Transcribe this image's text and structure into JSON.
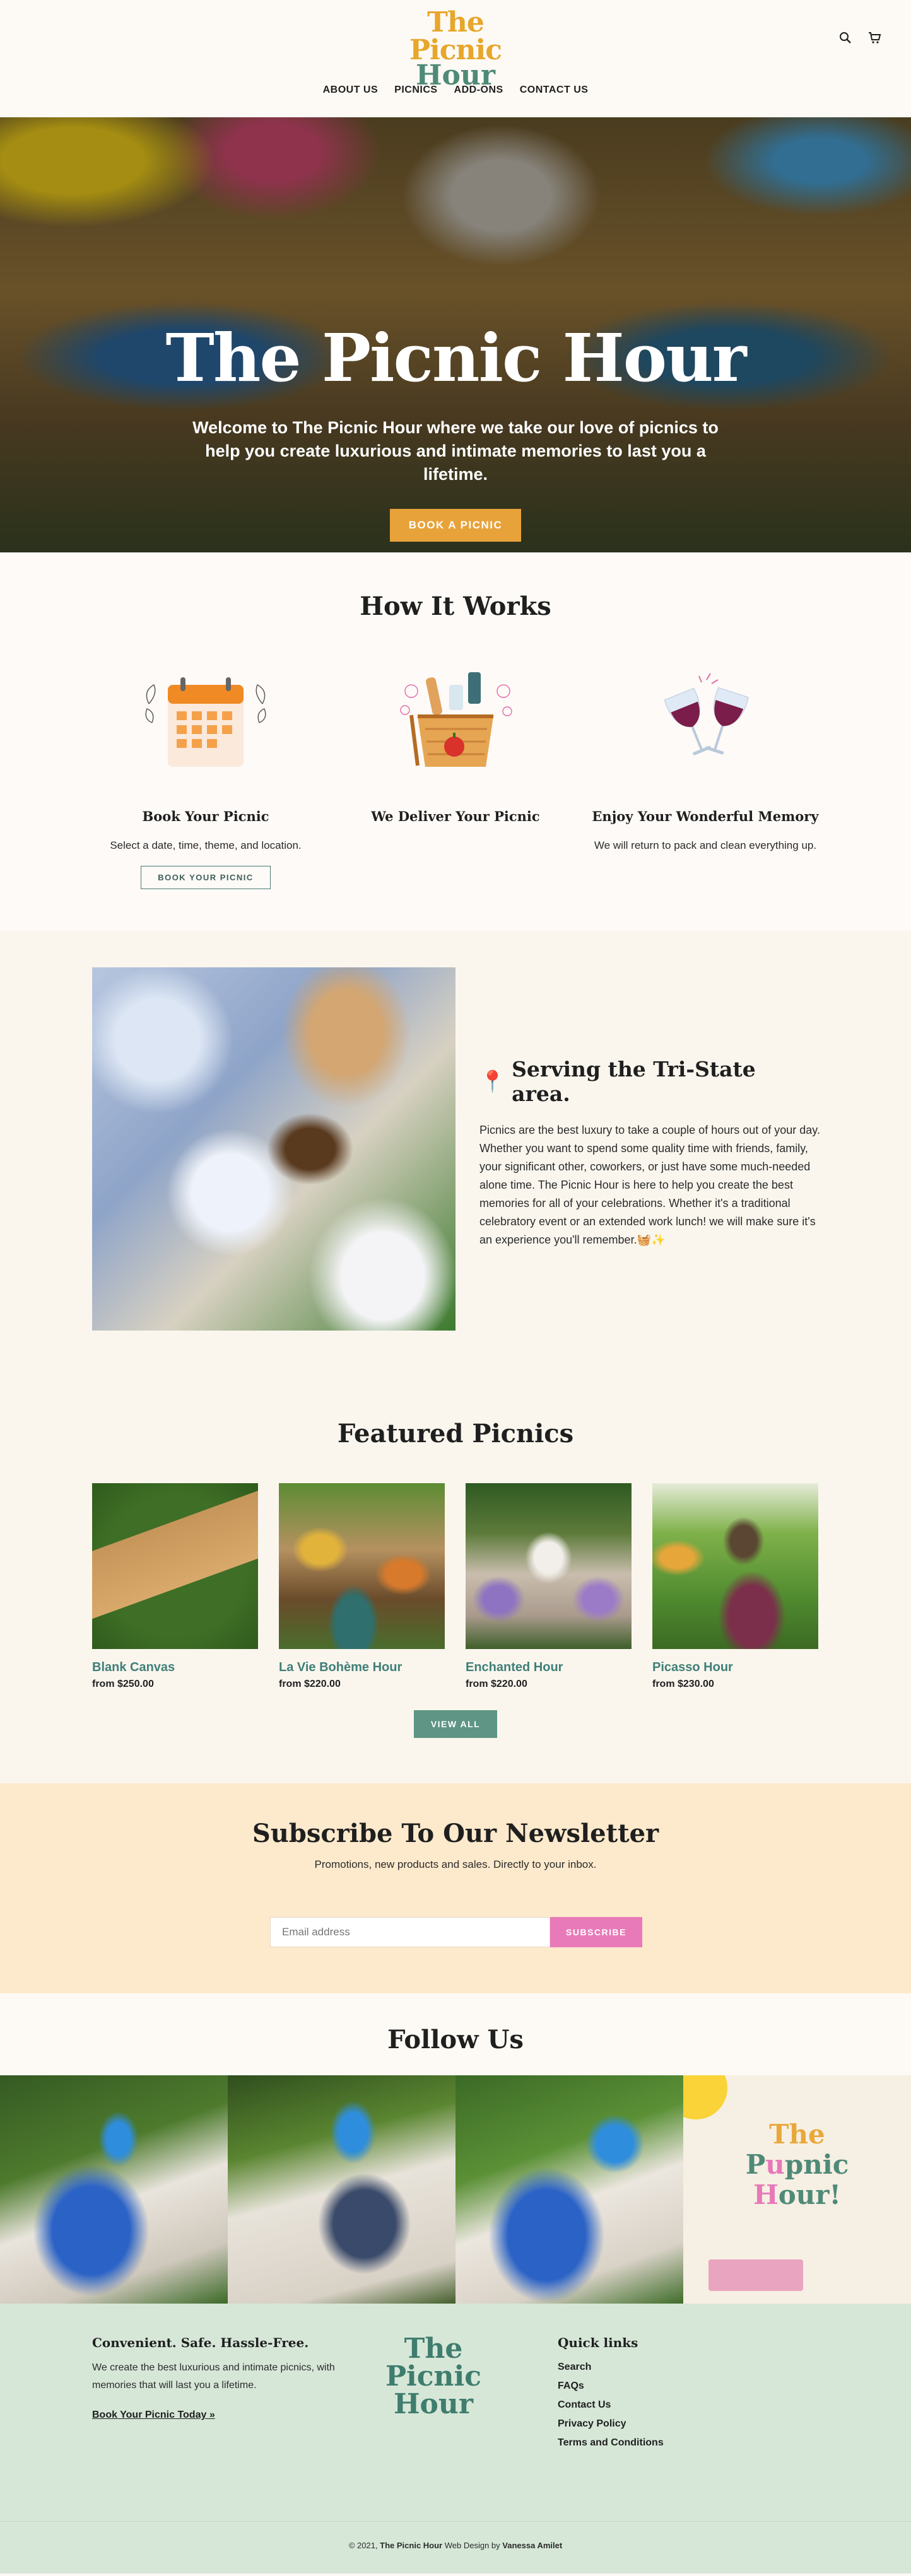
{
  "header": {
    "logo_line1": "The Picnic",
    "logo_line2": "Hour",
    "search_icon": "search-icon",
    "cart_icon": "cart-icon",
    "nav": [
      "ABOUT US",
      "PICNICS",
      "ADD-ONS",
      "CONTACT US"
    ]
  },
  "hero": {
    "title": "The Picnic Hour",
    "text": "Welcome to The Picnic Hour where we take our love of picnics to help you create luxurious and intimate memories to last you a lifetime.",
    "button": "BOOK A PICNIC"
  },
  "how": {
    "title": "How It Works",
    "steps": [
      {
        "title": "Book Your Picnic",
        "text": "Select a date, time, theme, and location.",
        "button": "BOOK YOUR PICNIC"
      },
      {
        "title": "We Deliver Your Picnic",
        "text": ""
      },
      {
        "title": "Enjoy Your Wonderful Memory",
        "text": "We will return to pack and clean everything up."
      }
    ]
  },
  "serving": {
    "pin": "📍",
    "title": "Serving the Tri-State area.",
    "body": "Picnics are the best luxury to take a couple of hours out of your day. Whether you want to spend some quality time with friends, family, your significant other, coworkers, or just have some much-needed alone time. The Picnic Hour is here to help you create the best memories for all of your celebrations. Whether it's a traditional celebratory event or an extended work lunch! we will make sure it's an experience you'll remember.🧺✨"
  },
  "featured": {
    "title": "Featured Picnics",
    "products": [
      {
        "name": "Blank Canvas",
        "price": "from $250.00"
      },
      {
        "name": "La Vie Bohème Hour",
        "price": "from $220.00"
      },
      {
        "name": "Enchanted Hour",
        "price": "from $220.00"
      },
      {
        "name": "Picasso Hour",
        "price": "from $230.00"
      }
    ],
    "view_all": "VIEW ALL"
  },
  "newsletter": {
    "title": "Subscribe To Our Newsletter",
    "subtitle": "Promotions, new products and sales. Directly to your inbox.",
    "placeholder": "Email address",
    "button": "SUBSCRIBE"
  },
  "follow": {
    "title": "Follow Us",
    "promo_line1": "The",
    "promo_line2a": "P",
    "promo_line2b": "u",
    "promo_line2c": "pnic",
    "promo_line3a": "H",
    "promo_line3b": "our!"
  },
  "footer": {
    "col1_title": "Convenient. Safe. Hassle-Free.",
    "col1_text": "We create the best luxurious and intimate picnics, with memories that will last you a lifetime.",
    "col1_link": "Book Your Picnic Today »",
    "logo_line1": "The",
    "logo_line2": "Picnic",
    "logo_line3": "Hour",
    "col3_title": "Quick links",
    "links": [
      "Search",
      "FAQs",
      "Contact Us",
      "Privacy Policy",
      "Terms and Conditions"
    ]
  },
  "copyright": {
    "prefix": "© 2021, ",
    "brand": "The Picnic Hour",
    "middle": " Web Design by ",
    "designer": "Vanessa Amilet"
  },
  "colors": {
    "accent_orange": "#e8a23a",
    "accent_pink": "#e97ab9",
    "accent_teal": "#5e9584",
    "footer_bg": "#d6e7d8",
    "newsletter_bg": "#fde9cc"
  }
}
